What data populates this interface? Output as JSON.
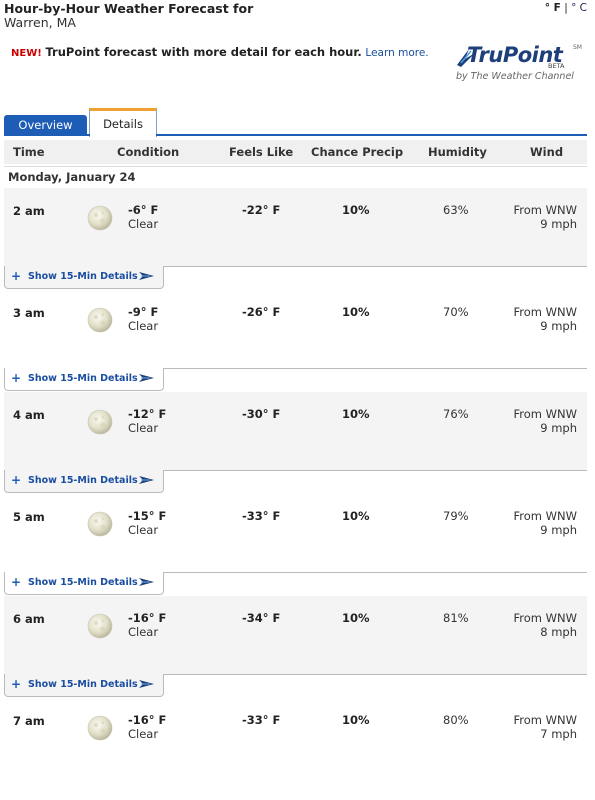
{
  "header": {
    "title": "Hour-by-Hour Weather Forecast for",
    "location": "Warren, MA",
    "unit_f": "° F",
    "unit_sep": " | ",
    "unit_c": "° C"
  },
  "promo": {
    "new_label": "NEW!",
    "message": "TruPoint forecast with more detail for each hour.",
    "learn_more": "Learn more."
  },
  "logo": {
    "brand": "TruPoint",
    "sm": "SM",
    "beta": "BETA",
    "subtitle": "by The Weather Channel"
  },
  "tabs": {
    "overview": "Overview",
    "details": "Details"
  },
  "columns": {
    "time": "Time",
    "condition": "Condition",
    "feels_like": "Feels Like",
    "chance_precip": "Chance Precip",
    "humidity": "Humidity",
    "wind": "Wind"
  },
  "day_label": "Monday, January 24",
  "detail_label": "Show 15-Min Details",
  "rows": [
    {
      "time": "2 am",
      "temp": "-6° F",
      "condition": "Clear",
      "feels": "-22° F",
      "precip": "10%",
      "humidity": "63%",
      "wind_dir": "From WNW",
      "wind_speed": "9 mph"
    },
    {
      "time": "3 am",
      "temp": "-9° F",
      "condition": "Clear",
      "feels": "-26° F",
      "precip": "10%",
      "humidity": "70%",
      "wind_dir": "From WNW",
      "wind_speed": "9 mph"
    },
    {
      "time": "4 am",
      "temp": "-12° F",
      "condition": "Clear",
      "feels": "-30° F",
      "precip": "10%",
      "humidity": "76%",
      "wind_dir": "From WNW",
      "wind_speed": "9 mph"
    },
    {
      "time": "5 am",
      "temp": "-15° F",
      "condition": "Clear",
      "feels": "-33° F",
      "precip": "10%",
      "humidity": "79%",
      "wind_dir": "From WNW",
      "wind_speed": "9 mph"
    },
    {
      "time": "6 am",
      "temp": "-16° F",
      "condition": "Clear",
      "feels": "-34° F",
      "precip": "10%",
      "humidity": "81%",
      "wind_dir": "From WNW",
      "wind_speed": "8 mph"
    },
    {
      "time": "7 am",
      "temp": "-16° F",
      "condition": "Clear",
      "feels": "-33° F",
      "precip": "10%",
      "humidity": "80%",
      "wind_dir": "From WNW",
      "wind_speed": "7 mph"
    }
  ],
  "icons": {
    "condition_icon": "moon-clear-icon",
    "expand_icon": "plus-icon",
    "arrow_icon": "arrow-right-icon"
  },
  "colors": {
    "tab_active_top": "#f0a030",
    "tab_overview_bg": "#1d5db5",
    "promo_new": "#cc0000"
  }
}
